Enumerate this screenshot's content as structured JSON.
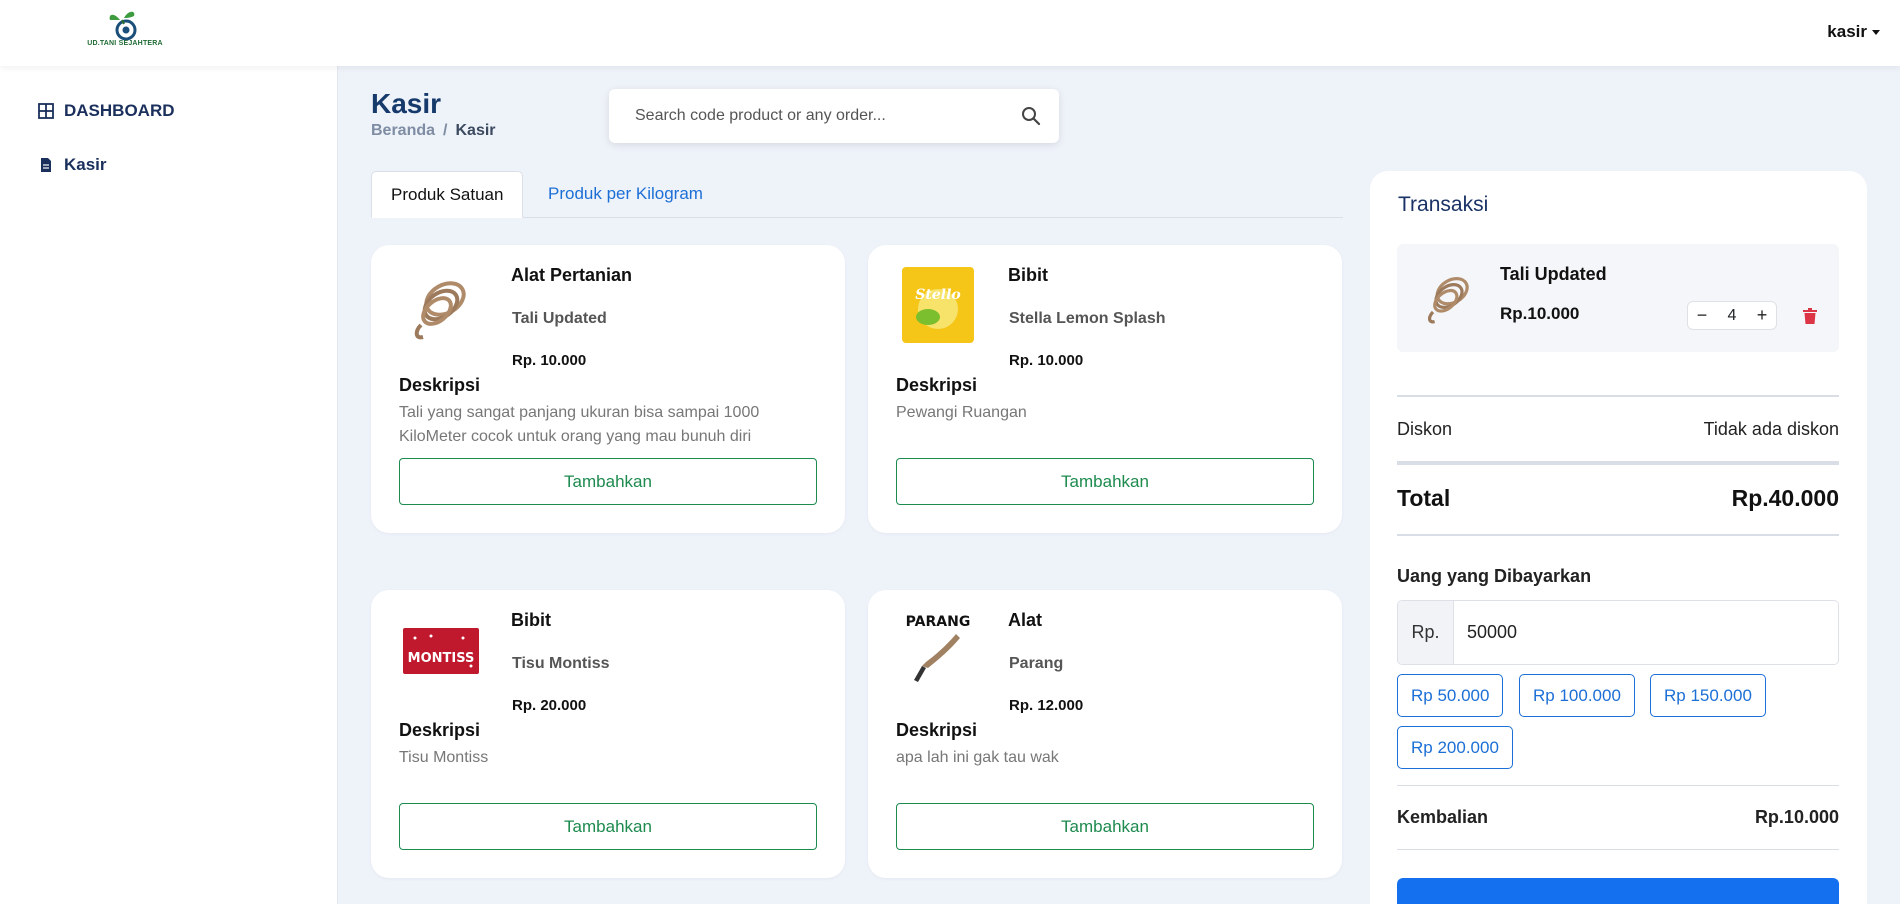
{
  "brand": {
    "name": "UD.TANI SEJAHTERA",
    "color": "#1f6b34"
  },
  "user": {
    "name": "kasir"
  },
  "sidebar": {
    "items": [
      {
        "label": "DASHBOARD",
        "icon": "grid-icon"
      },
      {
        "label": "Kasir",
        "icon": "file-icon"
      }
    ]
  },
  "header": {
    "title": "Kasir",
    "breadcrumb": [
      "Beranda",
      "/",
      "Kasir"
    ]
  },
  "search": {
    "placeholder": "Search code product or any order...",
    "value": ""
  },
  "tabs": [
    {
      "label": "Produk Satuan",
      "active": true
    },
    {
      "label": "Produk per Kilogram",
      "active": false
    }
  ],
  "products": [
    {
      "category": "Alat Pertanian",
      "name": "Tali Updated",
      "price": "Rp. 10.000",
      "desc_heading": "Deskripsi",
      "desc": "Tali yang sangat panjang ukuran bisa sampai 1000 KiloMeter cocok untuk orang yang mau bunuh diri",
      "button": "Tambahkan",
      "image": "rope-image"
    },
    {
      "category": "Bibit",
      "name": "Stella Lemon Splash",
      "price": "Rp. 10.000",
      "desc_heading": "Deskripsi",
      "desc": "Pewangi Ruangan",
      "button": "Tambahkan",
      "image": "stella-image",
      "image_text": "Stello"
    },
    {
      "category": "Bibit",
      "name": "Tisu Montiss",
      "price": "Rp. 20.000",
      "desc_heading": "Deskripsi",
      "desc": "Tisu Montiss",
      "button": "Tambahkan",
      "image": "tissue-image",
      "image_text": "MONTISS"
    },
    {
      "category": "Alat",
      "name": "Parang",
      "price": "Rp. 12.000",
      "desc_heading": "Deskripsi",
      "desc": "apa lah ini gak tau wak",
      "button": "Tambahkan",
      "image": "parang-image",
      "image_text": "PARANG"
    }
  ],
  "transaction": {
    "title": "Transaksi",
    "item": {
      "name": "Tali Updated",
      "price": "Rp.10.000",
      "qty": "4",
      "minus": "−",
      "plus": "+"
    },
    "discount_label": "Diskon",
    "discount_value": "Tidak ada diskon",
    "total_label": "Total",
    "total_value": "Rp.40.000",
    "paid_label": "Uang yang Dibayarkan",
    "paid_prefix": "Rp.",
    "paid_value": "50000",
    "quick_amounts": [
      "Rp 50.000",
      "Rp 100.000",
      "Rp 150.000",
      "Rp 200.000"
    ],
    "change_label": "Kembalian",
    "change_value": "Rp.10.000",
    "accent": "#1570ef",
    "danger": "#dc3545"
  }
}
